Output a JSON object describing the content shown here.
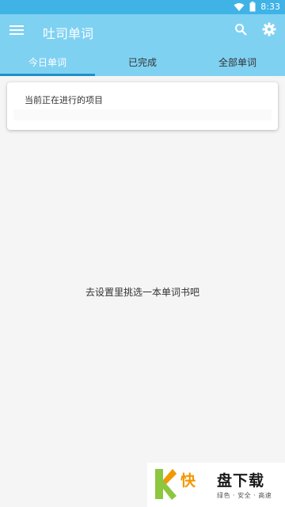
{
  "status_bar": {
    "time": "8:33",
    "icons": [
      "wifi-icon",
      "battery-icon"
    ]
  },
  "app_bar": {
    "title": "吐司单词",
    "icons": [
      "menu-icon",
      "search-icon",
      "settings-icon"
    ]
  },
  "tabs": [
    {
      "label": "今日单词",
      "active": true
    },
    {
      "label": "已完成",
      "active": false
    },
    {
      "label": "全部单词",
      "active": false
    }
  ],
  "current_project": {
    "title": "当前正在进行的项目"
  },
  "empty_message": "去设置里挑选一本单词书吧",
  "watermark": {
    "brand_part1": "快",
    "brand_part2": "盘下载",
    "tagline": "绿色 · 安全 · 高速"
  },
  "colors": {
    "status_bar": "#3fb3e6",
    "app_bar": "#7fd1f2",
    "tab_indicator": "#1e90c8",
    "background": "#f5f5f5"
  }
}
